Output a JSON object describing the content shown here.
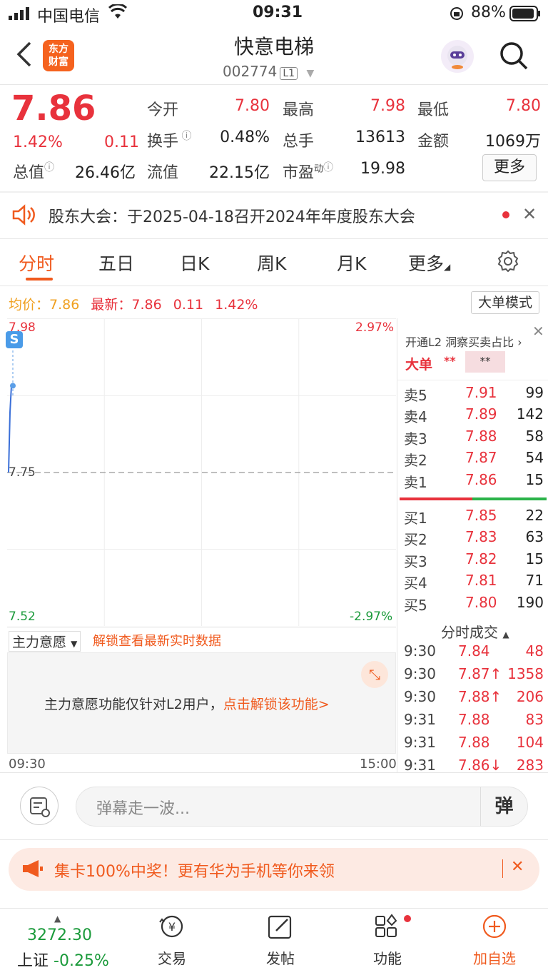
{
  "status_bar": {
    "carrier": "中国电信",
    "time": "09:31",
    "battery": "88%"
  },
  "header": {
    "logo_text_line1": "东方",
    "logo_text_line2": "财富",
    "stock_name": "快意电梯",
    "stock_code": "002774",
    "level_badge": "L1"
  },
  "quote": {
    "price": "7.86",
    "change_pct": "1.42%",
    "change": "0.11",
    "open_label": "今开",
    "open": "7.80",
    "high_label": "最高",
    "high": "7.98",
    "low_label": "最低",
    "low": "7.80",
    "turnover_label": "换手",
    "turnover": "0.48%",
    "volume_label": "总手",
    "volume": "13613",
    "amount_label": "金额",
    "amount": "1069万",
    "mktcap_label": "总值",
    "mktcap": "26.46亿",
    "float_label": "流值",
    "float_cap": "22.15亿",
    "pe_label": "市盈",
    "pe_sup": "动",
    "pe": "19.98",
    "more_button": "更多"
  },
  "notice": {
    "text": "股东大会：于2025-04-18召开2024年年度股东大会"
  },
  "tabs": [
    "分时",
    "五日",
    "日K",
    "周K",
    "月K",
    "更多"
  ],
  "info_line": {
    "avg_label": "均价：",
    "avg": "7.86",
    "latest_label": "最新：",
    "latest": "7.86",
    "chg": "0.11",
    "chg_pct": "1.42%",
    "mode_button": "大单模式"
  },
  "chart_data": {
    "type": "line",
    "y_top_label": "7.98",
    "y_mid_label": "7.75",
    "y_bottom_label": "7.52",
    "pct_top_label": "2.97%",
    "pct_bottom_label": "-2.97%",
    "x_start_label": "09:30",
    "x_end_label": "15:00",
    "ylim": [
      7.52,
      7.98
    ],
    "series": [
      {
        "values": [
          7.75,
          7.84,
          7.88
        ]
      }
    ]
  },
  "l2_panel": {
    "promo": "开通L2 洞察买卖占比",
    "big_order_label": "大单",
    "big_order_value": "**",
    "big_order_value2": "**"
  },
  "order_book": {
    "asks": [
      {
        "label": "卖5",
        "price": "7.91",
        "vol": "99"
      },
      {
        "label": "卖4",
        "price": "7.89",
        "vol": "142"
      },
      {
        "label": "卖3",
        "price": "7.88",
        "vol": "58"
      },
      {
        "label": "卖2",
        "price": "7.87",
        "vol": "54"
      },
      {
        "label": "卖1",
        "price": "7.86",
        "vol": "15"
      }
    ],
    "bids": [
      {
        "label": "买1",
        "price": "7.85",
        "vol": "22"
      },
      {
        "label": "买2",
        "price": "7.83",
        "vol": "63"
      },
      {
        "label": "买3",
        "price": "7.82",
        "vol": "15"
      },
      {
        "label": "买4",
        "price": "7.81",
        "vol": "71"
      },
      {
        "label": "买5",
        "price": "7.80",
        "vol": "190"
      }
    ]
  },
  "trades": {
    "title": "分时成交",
    "rows": [
      {
        "time": "9:30",
        "price": "7.84",
        "vol": "48"
      },
      {
        "time": "9:30",
        "price": "7.87↑",
        "vol": "1358"
      },
      {
        "time": "9:30",
        "price": "7.88↑",
        "vol": "206"
      },
      {
        "time": "9:31",
        "price": "7.88",
        "vol": "83"
      },
      {
        "time": "9:31",
        "price": "7.88",
        "vol": "104"
      },
      {
        "time": "9:31",
        "price": "7.86↓",
        "vol": "283"
      }
    ]
  },
  "main_force": {
    "dropdown": "主力意愿",
    "unlock_link": "解锁查看最新实时数据",
    "message": "主力意愿功能仅针对L2用户，",
    "message_link": "点击解锁该功能>"
  },
  "danmu": {
    "placeholder": "弹幕走一波...",
    "button": "弹"
  },
  "promo_banner": {
    "text": "集卡100%中奖！更有华为手机等你来领"
  },
  "bottom_nav": {
    "index_value": "3272.30",
    "index_name": "上证",
    "index_change": "-0.25%",
    "items": [
      "交易",
      "发帖",
      "功能",
      "加自选"
    ]
  }
}
